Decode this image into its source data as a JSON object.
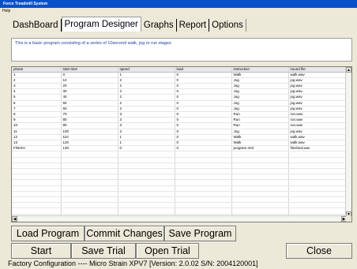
{
  "window": {
    "title": "Force Treadmill System"
  },
  "menu": {
    "help": "Help"
  },
  "tabs": [
    {
      "label": "DashBoard"
    },
    {
      "label": "Program Designer"
    },
    {
      "label": "Graphs"
    },
    {
      "label": "Report"
    },
    {
      "label": "Options"
    }
  ],
  "description": "This is a basic program consisting of a series of 10second walk, jog or run stages",
  "table": {
    "columns": [
      "phase",
      "start time",
      "speed",
      "load",
      "instruction",
      "sound file"
    ],
    "rows": [
      [
        "1",
        "0",
        "1",
        "0",
        "Walk",
        "walk.wav"
      ],
      [
        "2",
        "10",
        "2",
        "0",
        "Jog",
        "jog.wav"
      ],
      [
        "3",
        "20",
        "2",
        "0",
        "Jog",
        "jog.wav"
      ],
      [
        "4",
        "30",
        "2",
        "0",
        "Jog",
        "jog.wav"
      ],
      [
        "5",
        "40",
        "2",
        "0",
        "Jog",
        "jog.wav"
      ],
      [
        "6",
        "50",
        "2",
        "0",
        "Jog",
        "jog.wav"
      ],
      [
        "7",
        "60",
        "2",
        "0",
        "Jog",
        "jog.wav"
      ],
      [
        "8",
        "70",
        "3",
        "0",
        "Run",
        "run.wav"
      ],
      [
        "9",
        "80",
        "3",
        "0",
        "Run",
        "run.wav"
      ],
      [
        "10",
        "90",
        "3",
        "0",
        "Run",
        "run.wav"
      ],
      [
        "11",
        "100",
        "2",
        "0",
        "Jog",
        "jog.wav"
      ],
      [
        "12",
        "110",
        "1",
        "0",
        "Walk",
        "walk.wav"
      ],
      [
        "13",
        "120",
        "1",
        "0",
        "Walk",
        "walk.wav"
      ],
      [
        "FINISH",
        "130",
        "0",
        "0",
        "program end",
        "finished.wav"
      ]
    ]
  },
  "buttons": {
    "load_program": "Load Program",
    "commit_changes": "Commit Changes",
    "save_program": "Save Program",
    "start": "Start",
    "save_trial": "Save Trial",
    "open_trial": "Open Trial",
    "close": "Close"
  },
  "status": {
    "text": "Factory Configuration  ----  Micro Strain XPV7 [Version: 2.0.02 S/N: 2004120001]"
  }
}
